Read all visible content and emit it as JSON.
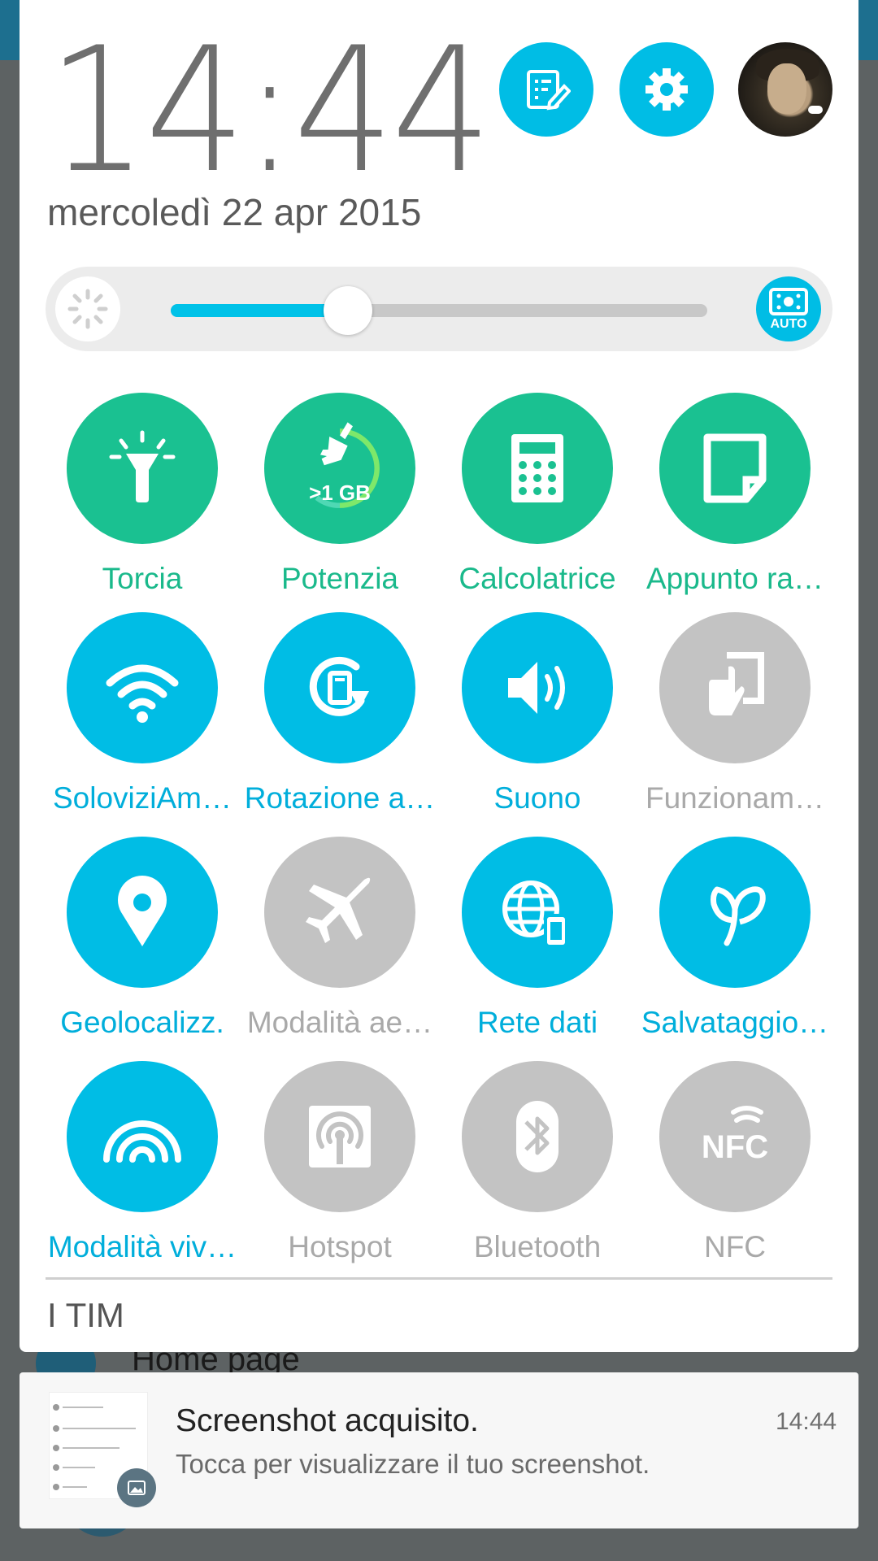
{
  "status": {
    "time": "14:44",
    "date": "mercoledì 22 apr 2015"
  },
  "header_buttons": [
    {
      "name": "edit-quick-settings",
      "icon": "edit-list-icon"
    },
    {
      "name": "settings",
      "icon": "gear-icon"
    },
    {
      "name": "user-profile",
      "icon": "avatar"
    }
  ],
  "brightness": {
    "level": 0.33,
    "auto_label": "AUTO",
    "accent": "#00c2e8"
  },
  "tiles": [
    {
      "label": "Torcia",
      "icon": "flashlight-icon",
      "state": "green"
    },
    {
      "label": "Potenzia",
      "icon": "broom-icon",
      "state": "green",
      "badge": ">1 GB"
    },
    {
      "label": "Calcolatrice",
      "icon": "calculator-icon",
      "state": "green"
    },
    {
      "label": "Appunto ra…",
      "icon": "note-icon",
      "state": "green"
    },
    {
      "label": "SoloviziAm…",
      "icon": "wifi-icon",
      "state": "on"
    },
    {
      "label": "Rotazione a…",
      "icon": "rotate-icon",
      "state": "on"
    },
    {
      "label": "Suono",
      "icon": "speaker-icon",
      "state": "on"
    },
    {
      "label": "Funzionam…",
      "icon": "one-hand-icon",
      "state": "off"
    },
    {
      "label": "Geolocalizz.",
      "icon": "location-icon",
      "state": "on"
    },
    {
      "label": "Modalità ae…",
      "icon": "airplane-icon",
      "state": "off"
    },
    {
      "label": "Rete dati",
      "icon": "mobile-data-icon",
      "state": "on"
    },
    {
      "label": "Salvataggio…",
      "icon": "leaf-icon",
      "state": "on"
    },
    {
      "label": "Modalità viv…",
      "icon": "vivid-icon",
      "state": "on"
    },
    {
      "label": "Hotspot",
      "icon": "hotspot-icon",
      "state": "off"
    },
    {
      "label": "Bluetooth",
      "icon": "bluetooth-icon",
      "state": "off"
    },
    {
      "label": "NFC",
      "icon": "nfc-icon",
      "state": "off"
    }
  ],
  "carrier": "I TIM",
  "background": {
    "homepage_label": "Home page"
  },
  "notification": {
    "title": "Screenshot acquisito.",
    "body": "Tocca per visualizzare il tuo screenshot.",
    "time": "14:44"
  },
  "colors": {
    "green": "#1ac191",
    "blue": "#00bde5",
    "grey": "#c3c3c3"
  }
}
